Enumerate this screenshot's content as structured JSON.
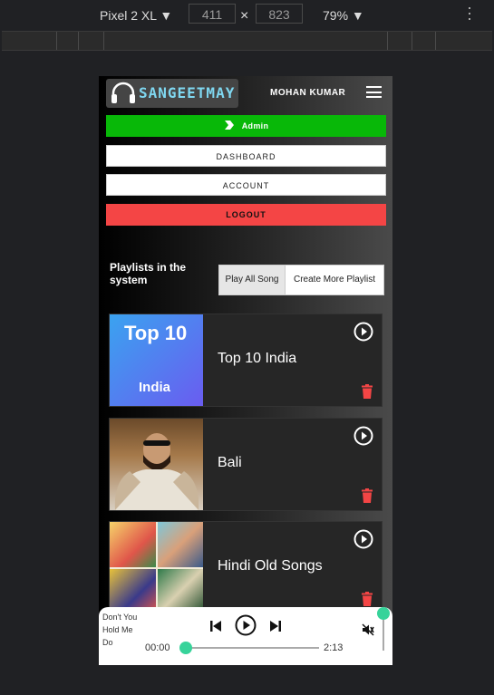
{
  "devtools": {
    "device": "Pixel 2 XL ▼",
    "width": "411",
    "height": "823",
    "times": "×",
    "zoom": "79% ▼"
  },
  "app": {
    "logo_text": "SANGEETMAY",
    "user_name": "MOHAN KUMAR",
    "menu": {
      "admin": "Admin",
      "dashboard": "DASHBOARD",
      "account": "ACCOUNT",
      "logout": "LOGOUT"
    },
    "playlists_title": "Playlists in the system",
    "play_all_label": "Play All Song",
    "create_more_label": "Create More Playlist",
    "playlists": [
      {
        "name": "Top 10 India",
        "thumb_line1": "Top 10",
        "thumb_line2": "India"
      },
      {
        "name": "Bali"
      },
      {
        "name": "Hindi Old Songs"
      }
    ],
    "player": {
      "track_title": "Don't You Hold Me Do",
      "current_time": "00:00",
      "duration": "2:13",
      "progress": 0,
      "volume_muted": true
    },
    "colors": {
      "accent_green": "#08b808",
      "logout_red": "#f44545",
      "trash_red": "#f44545",
      "knob": "#37d39a"
    }
  }
}
